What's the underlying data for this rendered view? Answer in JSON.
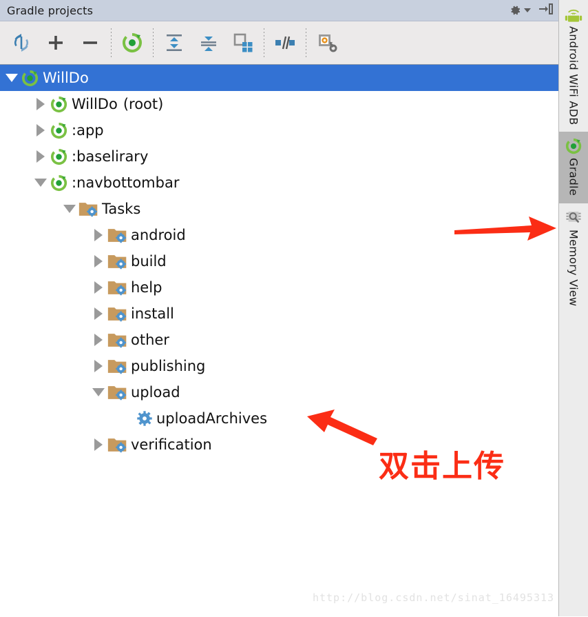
{
  "header": {
    "title": "Gradle projects",
    "settings_icon": "gear-icon",
    "settings_dropdown_icon": "chevron-down-icon",
    "hide_icon": "hide-panel-icon"
  },
  "toolbar": {
    "buttons": [
      {
        "name": "refresh-button",
        "icon": "refresh-sync-icon",
        "tooltip": "Refresh all Gradle projects"
      },
      {
        "name": "add-button",
        "icon": "plus-icon",
        "tooltip": "Link Gradle project"
      },
      {
        "name": "remove-button",
        "icon": "minus-icon",
        "tooltip": "Unlink Gradle project"
      },
      {
        "name": "execute-task-button",
        "icon": "gradle-run-icon",
        "tooltip": "Execute Gradle Task"
      },
      {
        "name": "expand-all-button",
        "icon": "expand-all-icon",
        "tooltip": "Expand All"
      },
      {
        "name": "collapse-all-button",
        "icon": "collapse-all-icon",
        "tooltip": "Collapse All"
      },
      {
        "name": "group-modules-button",
        "icon": "group-modules-icon",
        "tooltip": "Group Tasks"
      },
      {
        "name": "toggle-offline-button",
        "icon": "toggle-offline-icon",
        "tooltip": "Toggle Offline Mode"
      },
      {
        "name": "gradle-settings-button",
        "icon": "gradle-settings-icon",
        "tooltip": "Gradle Settings"
      }
    ]
  },
  "tree": {
    "rows": [
      {
        "label": "WillDo",
        "suffix": "",
        "indent": 0,
        "twisty": "down",
        "icon": "gradle-project-icon",
        "selected": true
      },
      {
        "label": "WillDo",
        "suffix": "(root)",
        "indent": 1,
        "twisty": "right",
        "icon": "gradle-module-icon",
        "selected": false
      },
      {
        "label": ":app",
        "suffix": "",
        "indent": 1,
        "twisty": "right",
        "icon": "gradle-module-icon",
        "selected": false
      },
      {
        "label": ":baselirary",
        "suffix": "",
        "indent": 1,
        "twisty": "right",
        "icon": "gradle-module-icon",
        "selected": false
      },
      {
        "label": ":navbottombar",
        "suffix": "",
        "indent": 1,
        "twisty": "down",
        "icon": "gradle-module-icon",
        "selected": false
      },
      {
        "label": "Tasks",
        "suffix": "",
        "indent": 2,
        "twisty": "down",
        "icon": "task-folder-icon",
        "selected": false
      },
      {
        "label": "android",
        "suffix": "",
        "indent": 3,
        "twisty": "right",
        "icon": "task-folder-icon",
        "selected": false
      },
      {
        "label": "build",
        "suffix": "",
        "indent": 3,
        "twisty": "right",
        "icon": "task-folder-icon",
        "selected": false
      },
      {
        "label": "help",
        "suffix": "",
        "indent": 3,
        "twisty": "right",
        "icon": "task-folder-icon",
        "selected": false
      },
      {
        "label": "install",
        "suffix": "",
        "indent": 3,
        "twisty": "right",
        "icon": "task-folder-icon",
        "selected": false
      },
      {
        "label": "other",
        "suffix": "",
        "indent": 3,
        "twisty": "right",
        "icon": "task-folder-icon",
        "selected": false
      },
      {
        "label": "publishing",
        "suffix": "",
        "indent": 3,
        "twisty": "right",
        "icon": "task-folder-icon",
        "selected": false
      },
      {
        "label": "upload",
        "suffix": "",
        "indent": 3,
        "twisty": "down",
        "icon": "task-folder-icon",
        "selected": false
      },
      {
        "label": "uploadArchives",
        "suffix": "",
        "indent": 4,
        "twisty": "none",
        "icon": "gradle-task-gear-icon",
        "selected": false
      },
      {
        "label": "verification",
        "suffix": "",
        "indent": 3,
        "twisty": "right",
        "icon": "task-folder-icon",
        "selected": false
      }
    ]
  },
  "annotations": {
    "note_text": "双击上传",
    "arrow_to_gradle_tab": "red-arrow-right-icon",
    "arrow_to_upload_archives": "red-arrow-left-icon"
  },
  "watermark": {
    "text": "http://blog.csdn.net/sinat_16495313"
  },
  "tool_strip": {
    "tabs": [
      {
        "label": "Android WiFi ADB",
        "icon": "android-wifi-icon",
        "active": false
      },
      {
        "label": "Gradle",
        "icon": "gradle-module-icon",
        "active": true
      },
      {
        "label": "Memory View",
        "icon": "memory-view-icon",
        "active": false
      }
    ]
  },
  "colors": {
    "selection_blue": "#3372d4",
    "header_bg": "#c8d0de",
    "toolbar_bg": "#eceaea",
    "annotation_red": "#fb2d15",
    "gradle_green": "#4aab3f",
    "folder_tan": "#c79a5e",
    "gear_blue": "#4f94cd"
  }
}
